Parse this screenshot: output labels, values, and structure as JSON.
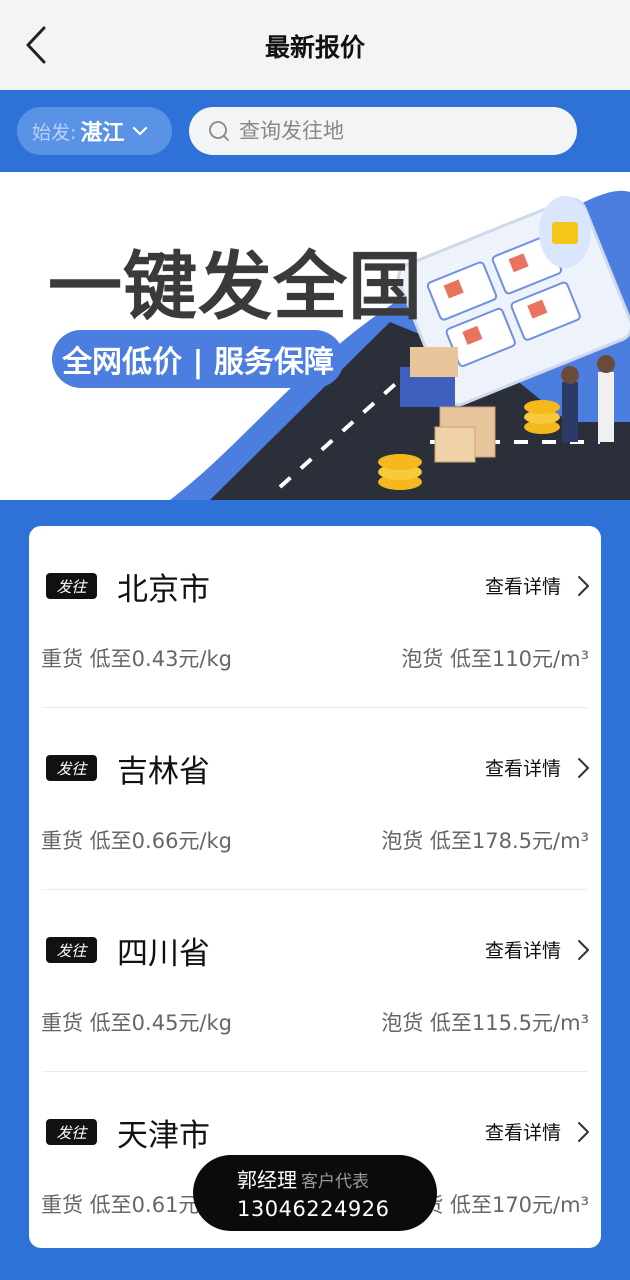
{
  "header": {
    "title": "最新报价"
  },
  "search": {
    "origin_label": "始发:",
    "origin_city": "湛江",
    "placeholder": "查询发往地"
  },
  "banner": {
    "headline": "一键发全国",
    "tagline": "全网低价 | 服务保障"
  },
  "quotes": [
    {
      "badge": "发往",
      "destination": "北京市",
      "detail": "查看详情",
      "heavy": "重货 低至0.43元/kg",
      "bulk": "泡货 低至110元/m³"
    },
    {
      "badge": "发往",
      "destination": "吉林省",
      "detail": "查看详情",
      "heavy": "重货 低至0.66元/kg",
      "bulk": "泡货 低至178.5元/m³"
    },
    {
      "badge": "发往",
      "destination": "四川省",
      "detail": "查看详情",
      "heavy": "重货 低至0.45元/kg",
      "bulk": "泡货 低至115.5元/m³"
    },
    {
      "badge": "发往",
      "destination": "天津市",
      "detail": "查看详情",
      "heavy": "重货 低至0.61元/kg",
      "bulk": "泡货 低至170元/m³"
    }
  ],
  "contact": {
    "name": "郭经理",
    "role": "客户代表",
    "phone": "13046224926"
  },
  "colors": {
    "primary": "#2e72d8",
    "banner_accent": "#4c7ee0",
    "contact_bg": "#0b0b0b"
  }
}
